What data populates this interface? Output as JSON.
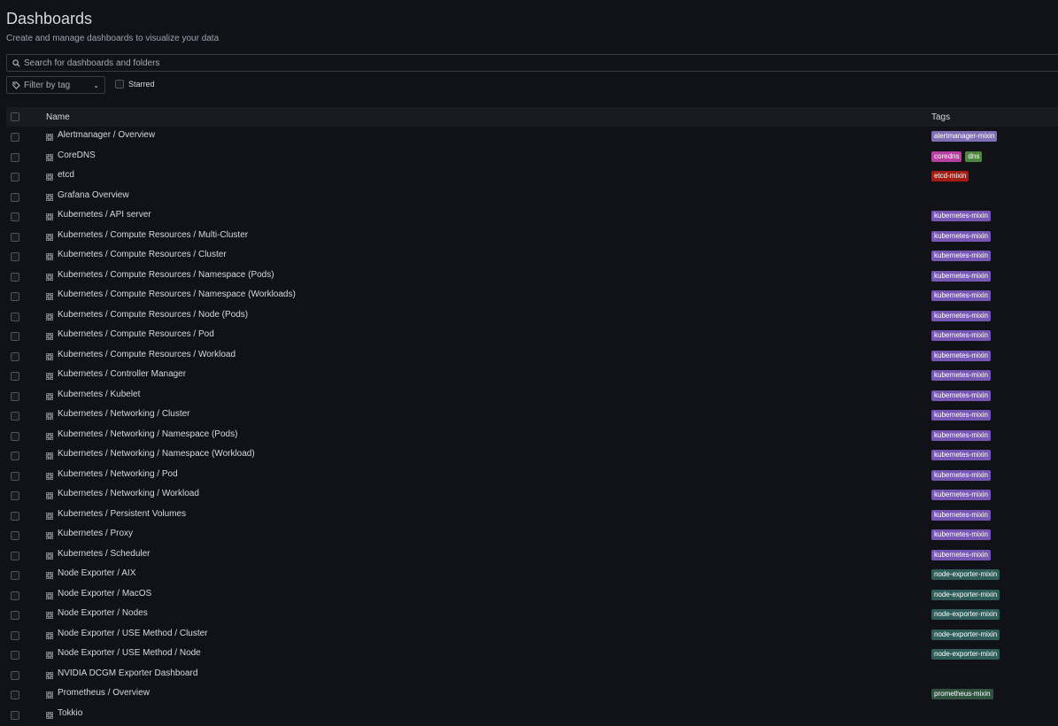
{
  "header": {
    "title": "Dashboards",
    "subtitle": "Create and manage dashboards to visualize your data"
  },
  "search": {
    "placeholder": "Search for dashboards and folders"
  },
  "filter": {
    "label": "Filter by tag"
  },
  "starred": {
    "label": "Starred"
  },
  "table": {
    "columns": {
      "name": "Name",
      "tags": "Tags"
    },
    "rows": [
      {
        "name": "Alertmanager / Overview",
        "tags": [
          {
            "label": "alertmanager-mixin",
            "color": "#806eb7"
          }
        ]
      },
      {
        "name": "CoreDNS",
        "tags": [
          {
            "label": "coredns",
            "color": "#b83fa0"
          },
          {
            "label": "dns",
            "color": "#508642"
          }
        ]
      },
      {
        "name": "etcd",
        "tags": [
          {
            "label": "etcd-mixin",
            "color": "#a51c13"
          }
        ]
      },
      {
        "name": "Grafana Overview",
        "tags": []
      },
      {
        "name": "Kubernetes / API server",
        "tags": [
          {
            "label": "kubernetes-mixin",
            "color": "#7757b4"
          }
        ]
      },
      {
        "name": "Kubernetes / Compute Resources / Multi-Cluster",
        "tags": [
          {
            "label": "kubernetes-mixin",
            "color": "#7757b4"
          }
        ]
      },
      {
        "name": "Kubernetes / Compute Resources / Cluster",
        "tags": [
          {
            "label": "kubernetes-mixin",
            "color": "#7757b4"
          }
        ]
      },
      {
        "name": "Kubernetes / Compute Resources / Namespace (Pods)",
        "tags": [
          {
            "label": "kubernetes-mixin",
            "color": "#7757b4"
          }
        ]
      },
      {
        "name": "Kubernetes / Compute Resources / Namespace (Workloads)",
        "tags": [
          {
            "label": "kubernetes-mixin",
            "color": "#7757b4"
          }
        ]
      },
      {
        "name": "Kubernetes / Compute Resources / Node (Pods)",
        "tags": [
          {
            "label": "kubernetes-mixin",
            "color": "#7757b4"
          }
        ]
      },
      {
        "name": "Kubernetes / Compute Resources / Pod",
        "tags": [
          {
            "label": "kubernetes-mixin",
            "color": "#7757b4"
          }
        ]
      },
      {
        "name": "Kubernetes / Compute Resources / Workload",
        "tags": [
          {
            "label": "kubernetes-mixin",
            "color": "#7757b4"
          }
        ]
      },
      {
        "name": "Kubernetes / Controller Manager",
        "tags": [
          {
            "label": "kubernetes-mixin",
            "color": "#7757b4"
          }
        ]
      },
      {
        "name": "Kubernetes / Kubelet",
        "tags": [
          {
            "label": "kubernetes-mixin",
            "color": "#7757b4"
          }
        ]
      },
      {
        "name": "Kubernetes / Networking / Cluster",
        "tags": [
          {
            "label": "kubernetes-mixin",
            "color": "#7757b4"
          }
        ]
      },
      {
        "name": "Kubernetes / Networking / Namespace (Pods)",
        "tags": [
          {
            "label": "kubernetes-mixin",
            "color": "#7757b4"
          }
        ]
      },
      {
        "name": "Kubernetes / Networking / Namespace (Workload)",
        "tags": [
          {
            "label": "kubernetes-mixin",
            "color": "#7757b4"
          }
        ]
      },
      {
        "name": "Kubernetes / Networking / Pod",
        "tags": [
          {
            "label": "kubernetes-mixin",
            "color": "#7757b4"
          }
        ]
      },
      {
        "name": "Kubernetes / Networking / Workload",
        "tags": [
          {
            "label": "kubernetes-mixin",
            "color": "#7757b4"
          }
        ]
      },
      {
        "name": "Kubernetes / Persistent Volumes",
        "tags": [
          {
            "label": "kubernetes-mixin",
            "color": "#7757b4"
          }
        ]
      },
      {
        "name": "Kubernetes / Proxy",
        "tags": [
          {
            "label": "kubernetes-mixin",
            "color": "#7757b4"
          }
        ]
      },
      {
        "name": "Kubernetes / Scheduler",
        "tags": [
          {
            "label": "kubernetes-mixin",
            "color": "#7757b4"
          }
        ]
      },
      {
        "name": "Node Exporter / AIX",
        "tags": [
          {
            "label": "node-exporter-mixin",
            "color": "#2f5e5a"
          }
        ]
      },
      {
        "name": "Node Exporter / MacOS",
        "tags": [
          {
            "label": "node-exporter-mixin",
            "color": "#2f5e5a"
          }
        ]
      },
      {
        "name": "Node Exporter / Nodes",
        "tags": [
          {
            "label": "node-exporter-mixin",
            "color": "#2f5e5a"
          }
        ]
      },
      {
        "name": "Node Exporter / USE Method / Cluster",
        "tags": [
          {
            "label": "node-exporter-mixin",
            "color": "#2f5e5a"
          }
        ]
      },
      {
        "name": "Node Exporter / USE Method / Node",
        "tags": [
          {
            "label": "node-exporter-mixin",
            "color": "#2f5e5a"
          }
        ]
      },
      {
        "name": "NVIDIA DCGM Exporter Dashboard",
        "tags": []
      },
      {
        "name": "Prometheus / Overview",
        "tags": [
          {
            "label": "prometheus-mixin",
            "color": "#2f5240"
          }
        ]
      },
      {
        "name": "Tokkio",
        "tags": []
      }
    ]
  },
  "icons": {
    "search": "search-icon",
    "tag": "tag-icon",
    "chevron": "chevron-down-icon",
    "dashboard": "dashboard-grid-icon"
  }
}
